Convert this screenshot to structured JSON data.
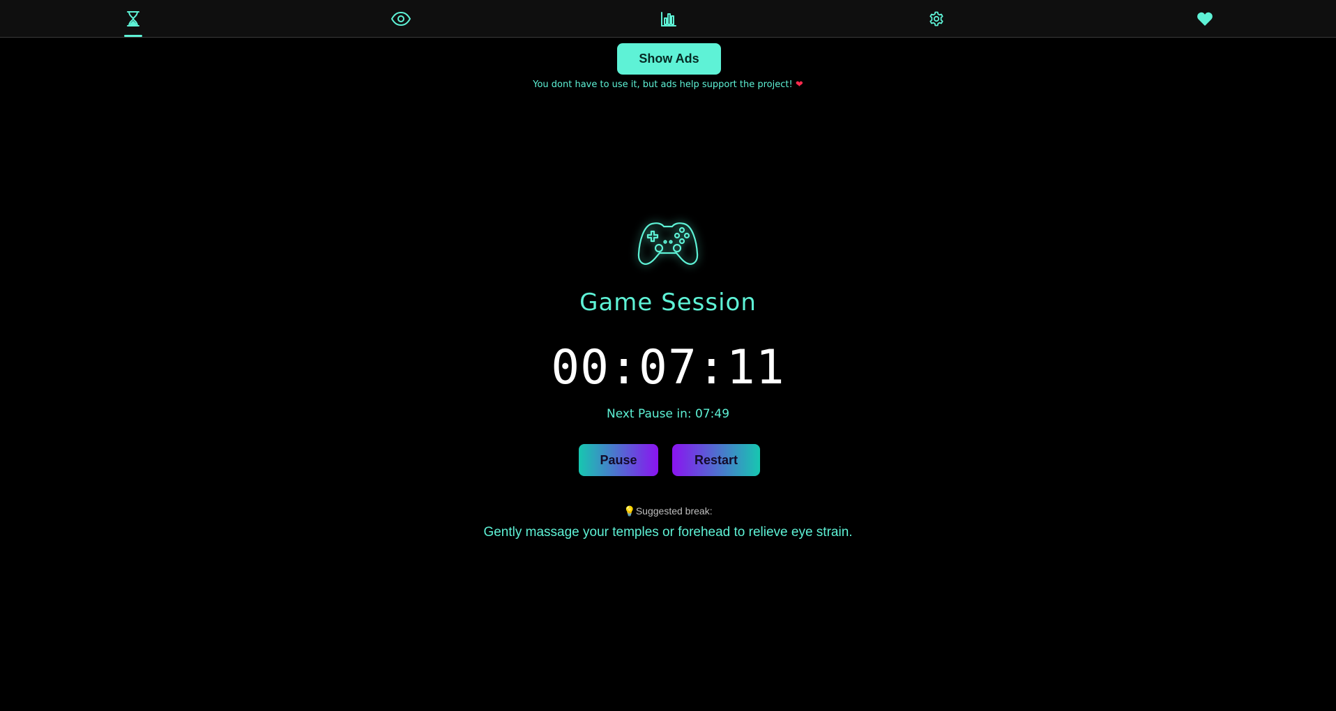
{
  "nav": {
    "items": [
      {
        "icon": "hourglass-icon",
        "active": true
      },
      {
        "icon": "eye-icon",
        "active": false
      },
      {
        "icon": "bar-chart-icon",
        "active": false
      },
      {
        "icon": "gear-icon",
        "active": false
      },
      {
        "icon": "heart-icon",
        "active": false
      }
    ]
  },
  "ads": {
    "button_label": "Show Ads",
    "note": "You dont have to use it, but ads help support the project!",
    "note_heart": "❤"
  },
  "session": {
    "icon": "gamepad-icon",
    "title": "Game Session",
    "timer": "00:07:11",
    "next_pause": "Next Pause in: 07:49"
  },
  "controls": {
    "pause_label": "Pause",
    "restart_label": "Restart"
  },
  "suggestion": {
    "icon": "lightbulb-icon",
    "label": "💡Suggested break:",
    "text": "Gently massage your temples or forehead to relieve eye strain."
  },
  "colors": {
    "accent": "#5ef2d6",
    "background": "#000000",
    "nav_background": "#0f0f0f",
    "gradient_teal": "#17c7b0",
    "gradient_purple": "#8a14f0",
    "heart": "#ff2a4d"
  }
}
